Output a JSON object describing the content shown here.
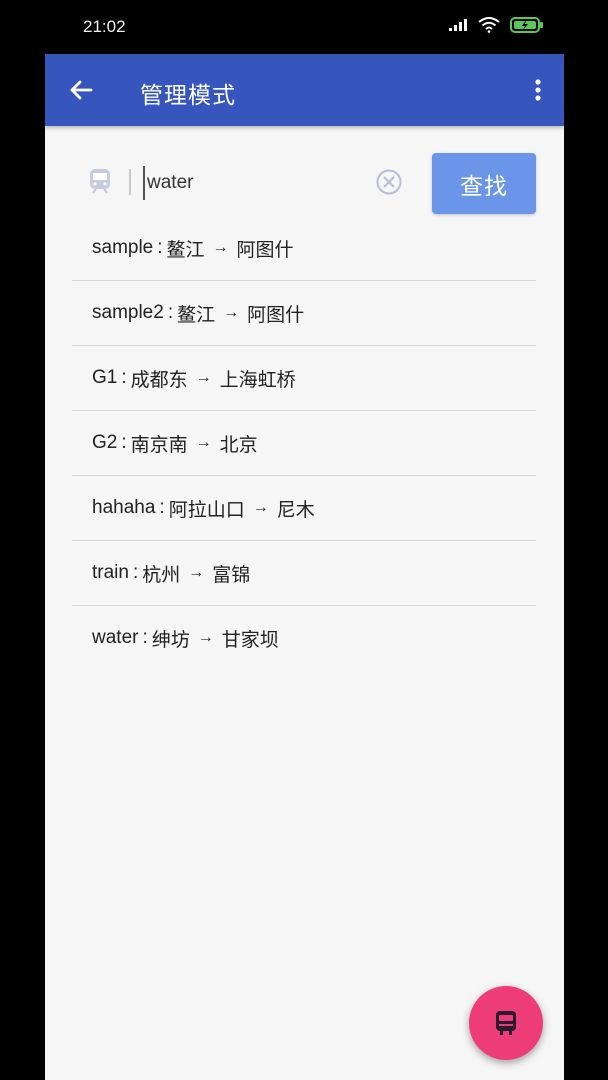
{
  "status_bar": {
    "time": "21:02"
  },
  "app_bar": {
    "title": "管理模式"
  },
  "search": {
    "value": "water",
    "button_label": "查找"
  },
  "routes": [
    {
      "code": "sample",
      "from": "鳌江",
      "to": "阿图什"
    },
    {
      "code": "sample2",
      "from": "鳌江",
      "to": "阿图什"
    },
    {
      "code": "G1",
      "from": "成都东",
      "to": "上海虹桥"
    },
    {
      "code": "G2",
      "from": "南京南",
      "to": "北京"
    },
    {
      "code": "hahaha",
      "from": "阿拉山口",
      "to": "尼木"
    },
    {
      "code": "train",
      "from": "杭州",
      "to": "富锦"
    },
    {
      "code": "water",
      "from": "绅坊",
      "to": "甘家坝"
    }
  ],
  "colors": {
    "app_bar": "#3756bd",
    "search_button": "#6a95e8",
    "fab": "#ee3c78"
  }
}
